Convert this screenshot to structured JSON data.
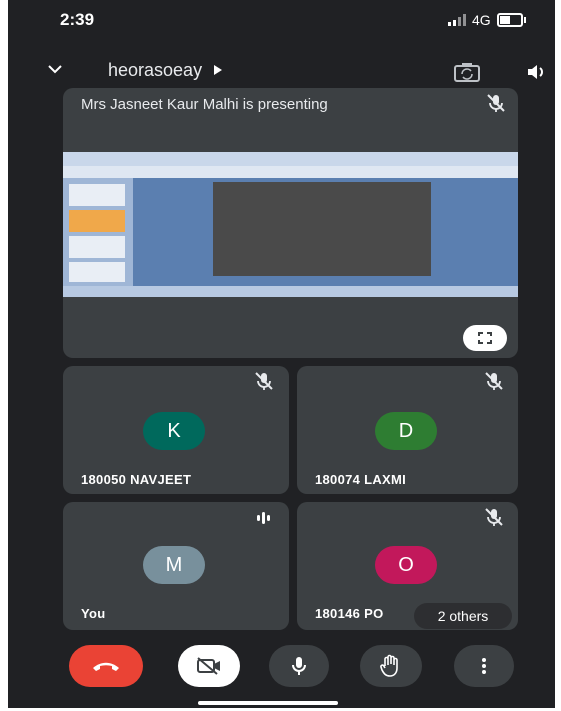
{
  "status_bar": {
    "time": "2:39",
    "network": "4G"
  },
  "meeting": {
    "title": "heorasoeay"
  },
  "presenter_tile": {
    "title": "Mrs Jasneet Kaur Malhi is presenting"
  },
  "participants": [
    {
      "initial": "K",
      "name": "180050 NAVJEET",
      "avatar_color": "#00695c"
    },
    {
      "initial": "D",
      "name": "180074 LAXMI",
      "avatar_color": "#2e7d32"
    },
    {
      "initial": "M",
      "name": "You",
      "avatar_color": "#78909c"
    },
    {
      "initial": "O",
      "name": "180146 PO",
      "avatar_color": "#c2185b"
    }
  ],
  "others_label": "2 others",
  "colors": {
    "background": "#202124",
    "tile": "#3c4043",
    "end_call": "#ea4335",
    "control": "#3c4043"
  },
  "icons": [
    "chevron-down-icon",
    "play-arrow-icon",
    "switch-camera-icon",
    "speaker-icon",
    "mic-off-icon",
    "fullscreen-icon",
    "end-call-icon",
    "camera-off-icon",
    "mic-icon",
    "raise-hand-icon",
    "more-icon"
  ]
}
